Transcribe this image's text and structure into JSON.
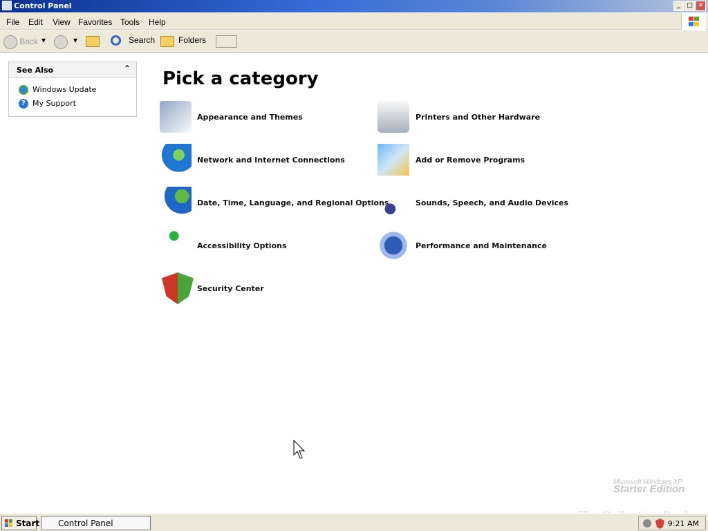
{
  "window": {
    "title": "Control Panel",
    "buttons": [
      "_",
      "□",
      "✕"
    ]
  },
  "menu": [
    "File",
    "Edit",
    "View",
    "Favorites",
    "Tools",
    "Help"
  ],
  "toolbar": {
    "back": "Back",
    "search": "Search",
    "folders": "Folders"
  },
  "sidebar": {
    "title": "See Also",
    "items": [
      "Windows Update",
      "My Support"
    ]
  },
  "main": {
    "heading": "Pick a category",
    "categories": [
      "Appearance and Themes",
      "Printers and Other Hardware",
      "Network and Internet Connections",
      "Add or Remove Programs",
      "Date, Time, Language, and Regional Options",
      "Sounds, Speech, and Audio Devices",
      "Accessibility Options",
      "Performance and Maintenance",
      "Security Center"
    ]
  },
  "watermark": {
    "line1": "Microsoft Windows XP",
    "line2": "Starter Edition"
  },
  "background_text": "The Collection Book",
  "taskbar": {
    "start": "Start",
    "app": "Control Panel",
    "time": "9:21 AM"
  }
}
